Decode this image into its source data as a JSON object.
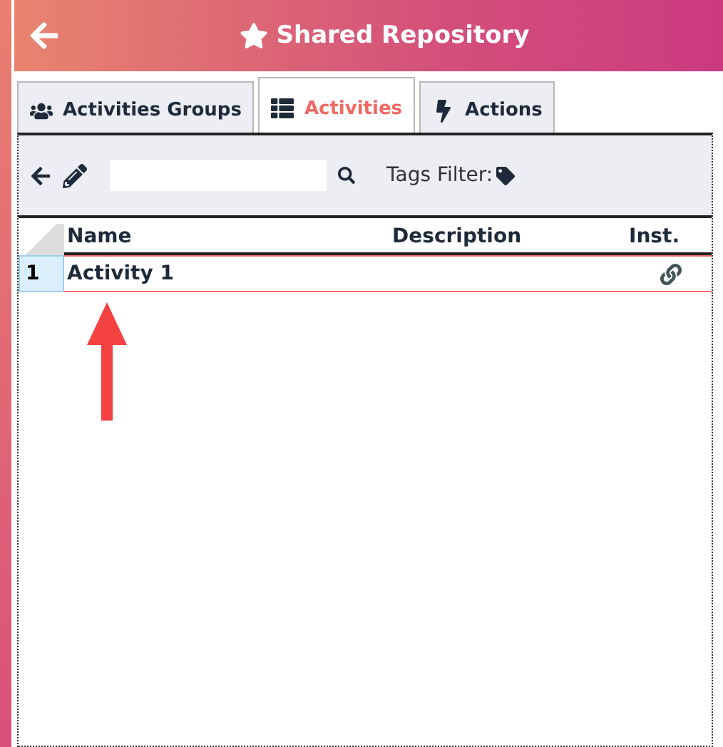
{
  "header": {
    "title": "Shared Repository"
  },
  "tabs": [
    {
      "label": "Activities Groups",
      "selected": false
    },
    {
      "label": "Activities",
      "selected": true
    },
    {
      "label": "Actions",
      "selected": false
    }
  ],
  "toolbar": {
    "tags_filter_label": "Tags Filter:"
  },
  "table": {
    "columns": [
      "Name",
      "Description",
      "Inst."
    ],
    "rows": [
      {
        "number": "1",
        "name": "Activity 1",
        "selected": true
      }
    ]
  }
}
